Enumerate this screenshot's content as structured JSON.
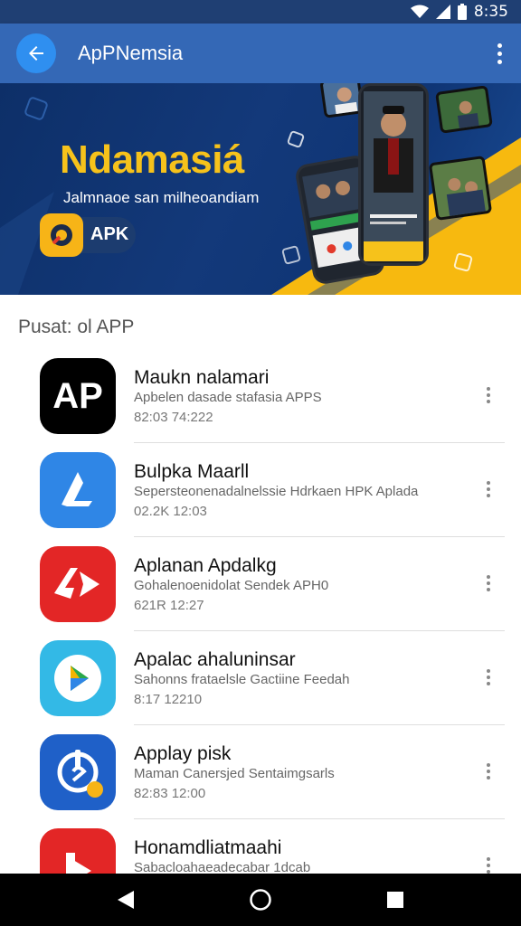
{
  "status_bar": {
    "time": "8:35",
    "icons": [
      "wifi-icon",
      "signal-icon",
      "battery-icon"
    ]
  },
  "app_bar": {
    "title": "ApPNemsia",
    "back_icon": "back-arrow-icon",
    "menu_icon": "more-vert-icon"
  },
  "banner": {
    "title": "Ndamasiá",
    "subtitle": "Jalmnaoe san milheoandiam",
    "apk_label": "APK"
  },
  "section": {
    "title": "Pusat: ol APP"
  },
  "apps": [
    {
      "name": "Maukn nalamari",
      "description": "Apbelen dasade stafasia APPS",
      "meta": "82:03 74:222",
      "icon_text": "AP",
      "icon_bg": "#000000"
    },
    {
      "name": "Bulpka Maarll",
      "description": "Sepersteonenadalnelssie Hdrkaen HPK Aplada",
      "meta": "02.2K 12:03",
      "icon_text": "",
      "icon_bg": "#2f86e6"
    },
    {
      "name": "Aplanan Apdalkg",
      "description": "Gohalenoenidolat Sendek APH0",
      "meta": "621R 12:27",
      "icon_text": "",
      "icon_bg": "#e32626"
    },
    {
      "name": "Apalac ahaluninsar",
      "description": "Sahonns frataelsle Gactiine Feedah",
      "meta": "8:17 12210",
      "icon_text": "",
      "icon_bg": "#33b9e6"
    },
    {
      "name": "Applay pisk",
      "description": "Maman Canersjed Sentaimgsarls",
      "meta": "82:83 12:00",
      "icon_text": "",
      "icon_bg": "#1f60c8"
    },
    {
      "name": "Honamdliatmaahi",
      "description": "Sabacloahaeadecabar 1dcab",
      "meta": "",
      "icon_text": "",
      "icon_bg": "#e32626"
    }
  ],
  "colors": {
    "status_bar": "#1f3f73",
    "app_bar": "#3468b6",
    "accent_yellow": "#f6c21b",
    "banner_blue": "#13397a"
  },
  "nav_bar": {
    "icons": [
      "back-triangle-icon",
      "home-circle-icon",
      "recents-square-icon"
    ]
  }
}
